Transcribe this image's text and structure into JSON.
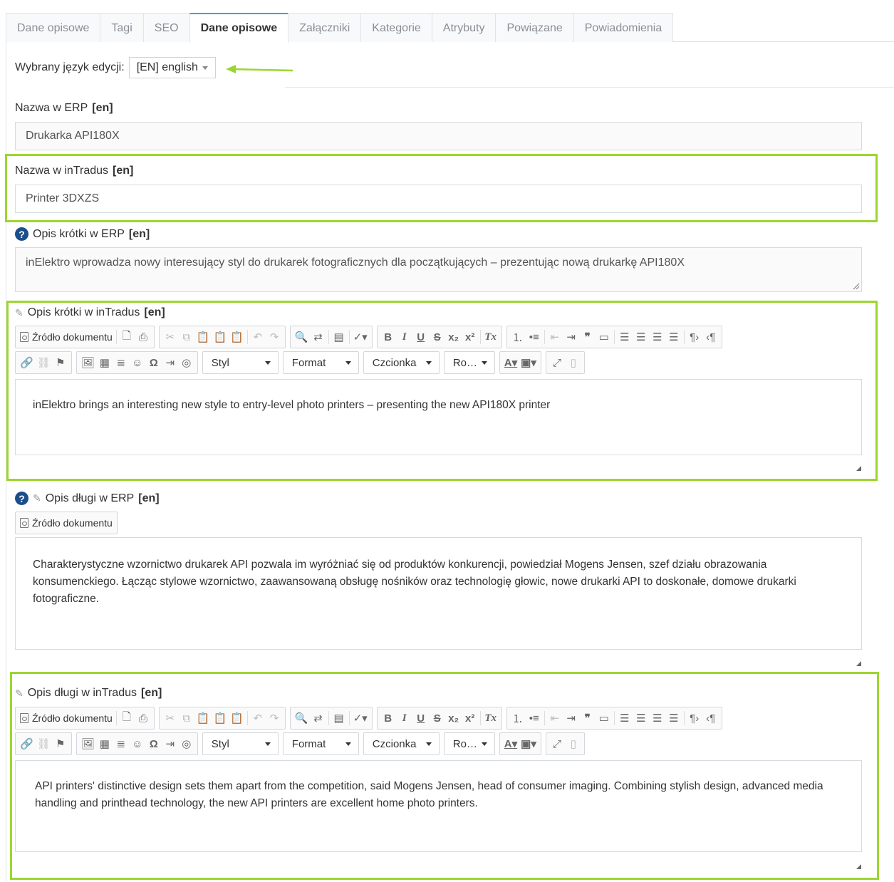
{
  "tabs": [
    {
      "label": "Dane opisowe"
    },
    {
      "label": "Tagi"
    },
    {
      "label": "SEO"
    },
    {
      "label": "Dane opisowe"
    },
    {
      "label": "Załączniki"
    },
    {
      "label": "Kategorie"
    },
    {
      "label": "Atrybuty"
    },
    {
      "label": "Powiązane"
    },
    {
      "label": "Powiadomienia"
    }
  ],
  "language": {
    "label": "Wybrany język edycji:",
    "value": "[EN] english"
  },
  "name_erp": {
    "label": "Nazwa w ERP",
    "lang": "[en]",
    "value": "Drukarka API180X"
  },
  "name_intradus": {
    "label": "Nazwa w inTradus",
    "lang": "[en]",
    "value": "Printer 3DXZS"
  },
  "short_erp": {
    "label": "Opis krótki w ERP",
    "lang": "[en]",
    "value": "inElektro wprowadza nowy interesujący styl do drukarek fotograficznych dla początkujących – prezentując nową drukarkę API180X"
  },
  "short_intradus": {
    "label": "Opis krótki w inTradus",
    "lang": "[en]",
    "value": "inElektro brings an interesting new style to entry-level photo printers – presenting the new API180X printer"
  },
  "long_erp": {
    "label": "Opis długi w ERP",
    "lang": "[en]",
    "value": "Charakterystyczne wzornictwo drukarek API pozwala im wyróżniać się od produktów konkurencji, powiedział Mogens Jensen, szef działu obrazowania konsumenckiego. Łącząc stylowe wzornictwo, zaawansowaną obsługę nośników oraz technologię głowic, nowe drukarki API to doskonałe, domowe drukarki fotograficzne."
  },
  "long_intradus": {
    "label": "Opis długi w inTradus",
    "lang": "[en]",
    "value": "API printers' distinctive design sets them apart from the competition, said Mogens Jensen, head of consumer imaging. Combining stylish design, advanced media handling and printhead technology, the new API printers are excellent home photo printers."
  },
  "toolbar": {
    "source": "Źródło dokumentu",
    "style": "Styl",
    "format": "Format",
    "font": "Czcionka",
    "size": "Ro…"
  },
  "colors": {
    "highlight": "#9bd62f",
    "active_tab": "#3ba0e6",
    "help_icon": "#1b4e8a"
  }
}
